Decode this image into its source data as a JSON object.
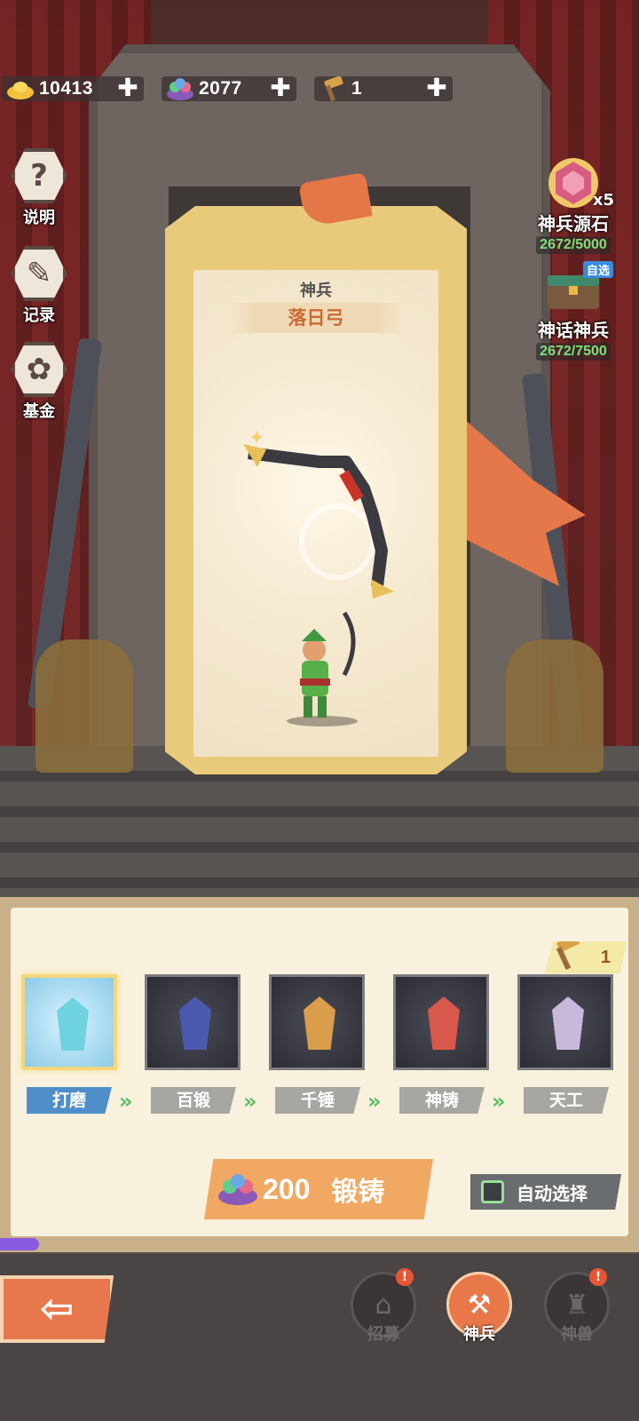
{
  "resources": {
    "gold": "10413",
    "gems": "2077",
    "hammers": "1",
    "plus": "✚"
  },
  "side_buttons": [
    {
      "label": "说明",
      "icon": "?"
    },
    {
      "label": "记录",
      "icon": "✎"
    },
    {
      "label": "基金",
      "icon": "✿"
    }
  ],
  "right_items": {
    "source_stone": {
      "label": "神兵源石",
      "count": "x5",
      "progress": "2672/5000"
    },
    "myth_weapon": {
      "label": "神话神兵",
      "badge": "自选",
      "progress": "2672/7500"
    }
  },
  "card": {
    "kind": "神兵",
    "name": "落日弓"
  },
  "forge": {
    "hammer_count": "1",
    "stages": [
      {
        "label": "打磨",
        "active": true,
        "color": "#6fd2df"
      },
      {
        "label": "百锻",
        "active": false,
        "color": "#4a5ab0"
      },
      {
        "label": "千锤",
        "active": false,
        "color": "#d99d4c"
      },
      {
        "label": "神铸",
        "active": false,
        "color": "#d8584c"
      },
      {
        "label": "天工",
        "active": false,
        "color": "#c8b8dc"
      }
    ],
    "chevron": "»",
    "cost": "200",
    "button_label": "锻铸",
    "auto_select_label": "自动选择"
  },
  "nav": {
    "back": "⇦",
    "items": [
      {
        "label": "招募",
        "active": false,
        "badge": "!"
      },
      {
        "label": "神兵",
        "active": true
      },
      {
        "label": "神兽",
        "active": false,
        "badge": "!"
      }
    ]
  },
  "colors": {
    "accent": "#e8784a",
    "active_stage": "#4f8ec9",
    "progress_green": "#7fe07a"
  }
}
